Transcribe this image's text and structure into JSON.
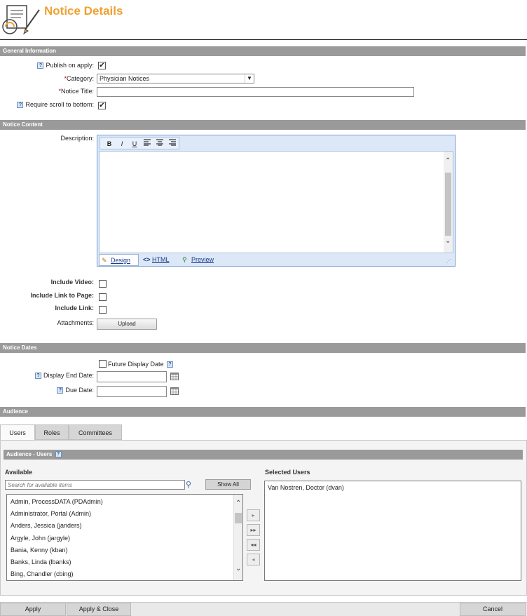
{
  "header": {
    "title": "Notice Details"
  },
  "sections": {
    "general": "General Information",
    "content": "Notice Content",
    "dates": "Notice Dates",
    "audience": "Audience"
  },
  "general": {
    "publish_label": "Publish on apply:",
    "publish_checked": "✔",
    "category_label": "Category:",
    "category_required": "*",
    "category_value": "Physician Notices",
    "title_label": "Notice Title:",
    "title_required": "*",
    "title_value": "",
    "scroll_label": "Require scroll to bottom:",
    "scroll_checked": "✔"
  },
  "content": {
    "description_label": "Description:",
    "toolbar": {
      "bold": "B",
      "italic": "I",
      "underline": "U"
    },
    "modes": {
      "design": "Design",
      "html": "HTML",
      "preview": "Preview"
    },
    "include_video_label": "Include Video:",
    "include_link_page_label": "Include Link to Page:",
    "include_link_label": "Include Link:",
    "attachments_label": "Attachments:",
    "upload_label": "Upload"
  },
  "dates": {
    "future_label": "Future Display Date",
    "end_date_label": "Display End Date:",
    "due_date_label": "Due Date:"
  },
  "audience": {
    "tabs": [
      "Users",
      "Roles",
      "Committees"
    ],
    "subsection": "Audience - Users",
    "available_label": "Available",
    "search_placeholder": "Search for available items",
    "show_all_label": "Show All",
    "selected_label": "Selected Users",
    "available_items": [
      "Admin, ProcessDATA (PDAdmin)",
      "Administrator, Portal (Admin)",
      "Anders, Jessica (janders)",
      "Argyle, John (jargyle)",
      "Bania, Kenny (kban)",
      "Banks, Linda (lbanks)",
      "Bing, Chandler (cbing)"
    ],
    "selected_items": [
      "Van Nostren, Doctor (dvan)"
    ]
  },
  "footer": {
    "apply": "Apply",
    "apply_close": "Apply & Close",
    "cancel": "Cancel"
  },
  "help_glyph": "?",
  "colors": {
    "title": "#f0a030",
    "section_bar": "#9a9a9a"
  }
}
